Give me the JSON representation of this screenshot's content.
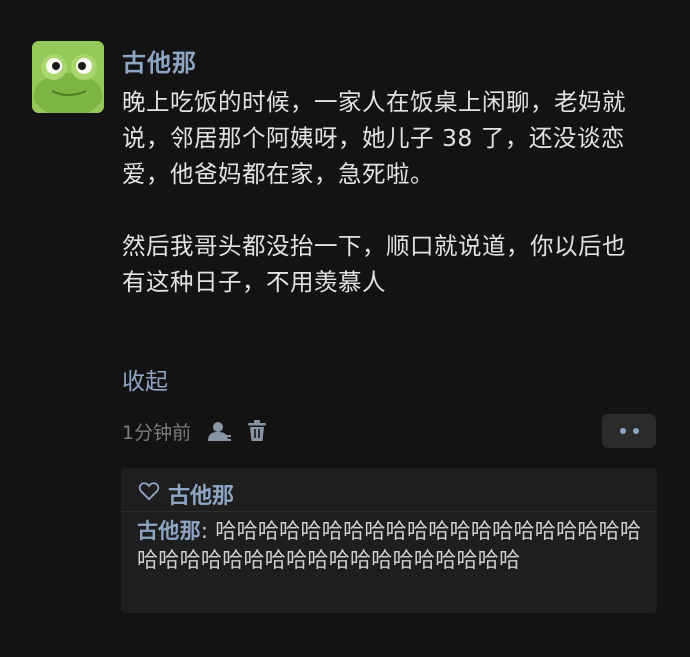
{
  "post": {
    "username": "古他那",
    "paragraph1": "晚上吃饭的时候，一家人在饭桌上闲聊，老妈就说，邻居那个阿姨呀，她儿子 38 了，还没谈恋爱，他爸妈都在家，急死啦。",
    "paragraph2": "然后我哥头都没抬一下，顺口就说道，你以后也有这种日子，不用羡慕人",
    "collapse_label": "收起",
    "timestamp": "1分钟前"
  },
  "likes": {
    "names": "古他那"
  },
  "reply": {
    "author": "古他那",
    "separator": ": ",
    "text": "哈哈哈哈哈哈哈哈哈哈哈哈哈哈哈哈哈哈哈哈哈哈哈哈哈哈哈哈哈哈哈哈哈哈哈哈哈哈"
  },
  "colors": {
    "background": "#131313",
    "accent": "#8ea5c4",
    "text": "#e2e2e2",
    "muted": "#7b7b7b",
    "card": "#1e1e1e"
  },
  "icons": {
    "avatar": "green-frog-avatar",
    "user": "user-icon",
    "delete": "trash-icon",
    "more": "more-dots-icon",
    "like": "heart-outline-icon"
  }
}
